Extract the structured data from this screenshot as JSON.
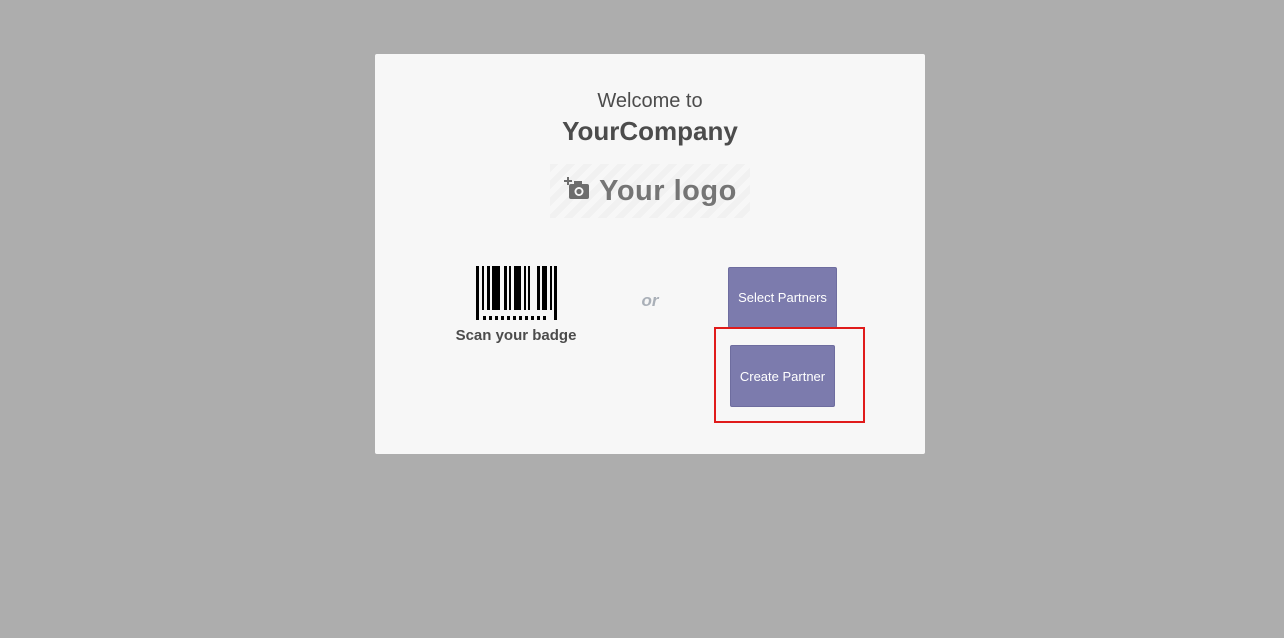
{
  "welcome": {
    "line1": "Welcome to",
    "company": "YourCompany"
  },
  "logo": {
    "text": "Your logo",
    "icon": "camera-add-icon"
  },
  "badge": {
    "icon": "barcode-icon",
    "label": "Scan your badge"
  },
  "separator": "or",
  "buttons": {
    "select_partners": "Select Partners",
    "create_partner": "Create Partner"
  },
  "colors": {
    "background": "#adadad",
    "card": "#f7f7f7",
    "button": "#7c7bad",
    "highlight": "#e01b1b"
  }
}
